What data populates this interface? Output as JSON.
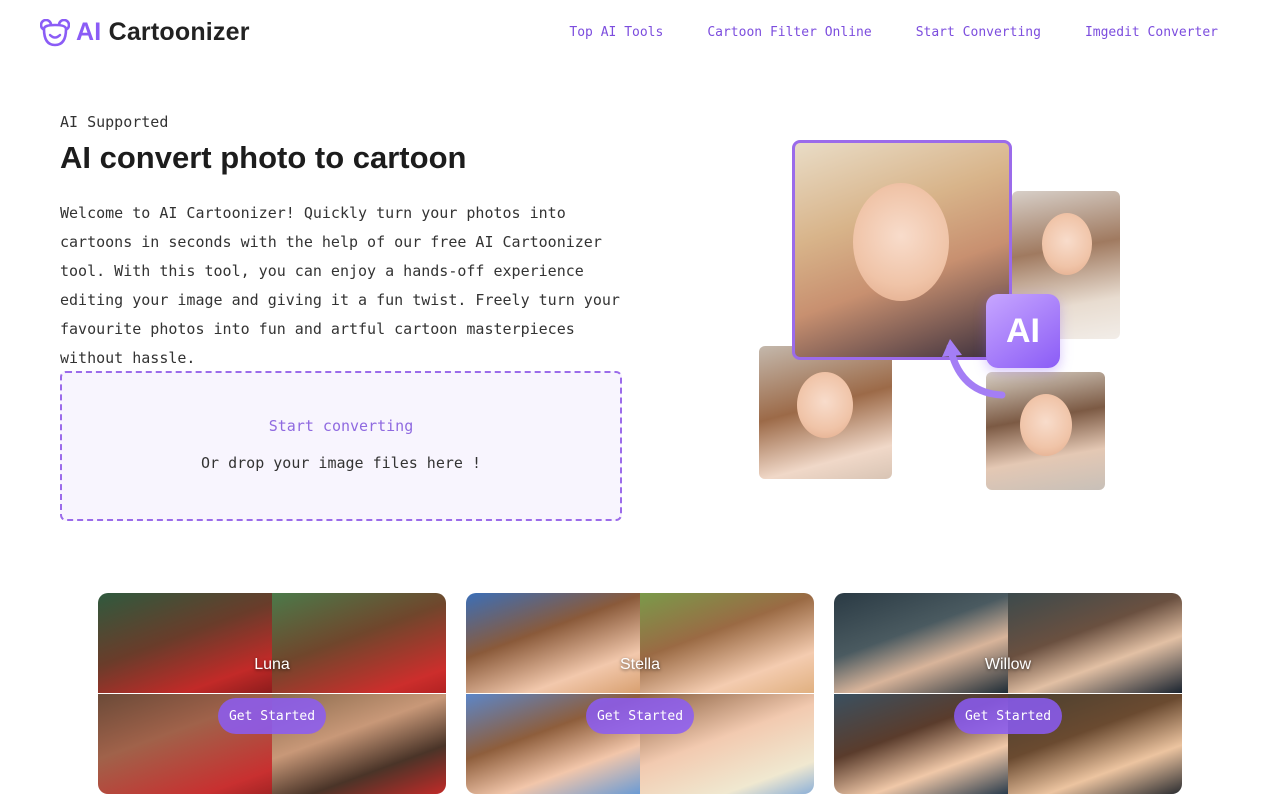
{
  "brand": {
    "prefix": "AI",
    "name": "Cartoonizer",
    "accent_color": "#8b5cf6",
    "logo_icon": "bear-icon"
  },
  "nav": {
    "items": [
      {
        "label": "Top AI Tools"
      },
      {
        "label": "Cartoon Filter Online"
      },
      {
        "label": "Start Converting"
      },
      {
        "label": "Imgedit Converter"
      }
    ]
  },
  "hero": {
    "eyebrow": "AI Supported",
    "title": "AI convert photo to cartoon",
    "description": "Welcome to AI Cartoonizer! Quickly turn your photos into cartoons in seconds with the help of our free AI Cartoonizer tool. With this tool, you can enjoy a hands-off experience editing your image and giving it a fun twist. Freely turn your favourite photos into fun and artful cartoon masterpieces without hassle.",
    "badge_text": "AI"
  },
  "upload": {
    "action_label": "Start converting",
    "drop_hint": "Or drop your image files here !"
  },
  "styles": {
    "cards": [
      {
        "name": "Luna",
        "button_label": "Get Started"
      },
      {
        "name": "Stella",
        "button_label": "Get Started"
      },
      {
        "name": "Willow",
        "button_label": "Get Started"
      }
    ]
  }
}
